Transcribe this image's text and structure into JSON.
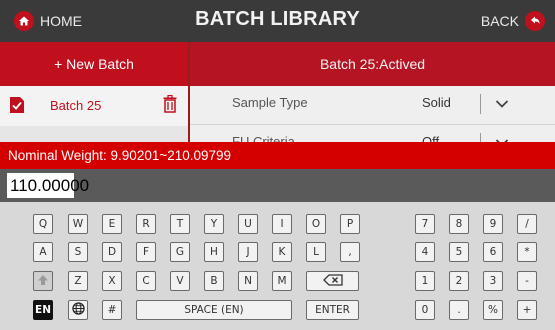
{
  "header": {
    "home_label": "HOME",
    "title": "BATCH LIBRARY",
    "back_label": "BACK"
  },
  "sidebar": {
    "new_batch_label": "+ New Batch",
    "batch_item_label": "Batch 25"
  },
  "main": {
    "batch_header": "Batch 25:Actived",
    "rows": [
      {
        "label": "Sample Type",
        "value": "Solid"
      },
      {
        "label": "FU Criteria",
        "value": "Off"
      }
    ]
  },
  "nominal_bar": "Nominal Weight: 9.90201~210.09799",
  "input": {
    "value": "110.00000"
  },
  "keyboard": {
    "row1": [
      "Q",
      "W",
      "E",
      "R",
      "T",
      "Y",
      "U",
      "I",
      "O",
      "P"
    ],
    "row2": [
      "A",
      "S",
      "D",
      "F",
      "G",
      "H",
      "J",
      "K",
      "L",
      ","
    ],
    "row3": [
      "Z",
      "X",
      "C",
      "V",
      "B",
      "N",
      "M"
    ],
    "lang": "EN",
    "hash": "#",
    "space": "SPACE (EN)",
    "enter": "ENTER",
    "num1": [
      "7",
      "8",
      "9",
      "/"
    ],
    "num2": [
      "4",
      "5",
      "6",
      "*"
    ],
    "num3": [
      "1",
      "2",
      "3",
      "-"
    ],
    "num4": [
      "0",
      ".",
      "%",
      "+"
    ]
  },
  "colors": {
    "accent": "#c0101e",
    "warning_bar": "#d40000",
    "topbar": "#3a3a3a"
  },
  "icons": [
    "home-icon",
    "back-arrow-icon",
    "document-check-icon",
    "trash-icon",
    "chevron-down-icon",
    "shift-up-icon",
    "backspace-icon",
    "globe-icon"
  ]
}
